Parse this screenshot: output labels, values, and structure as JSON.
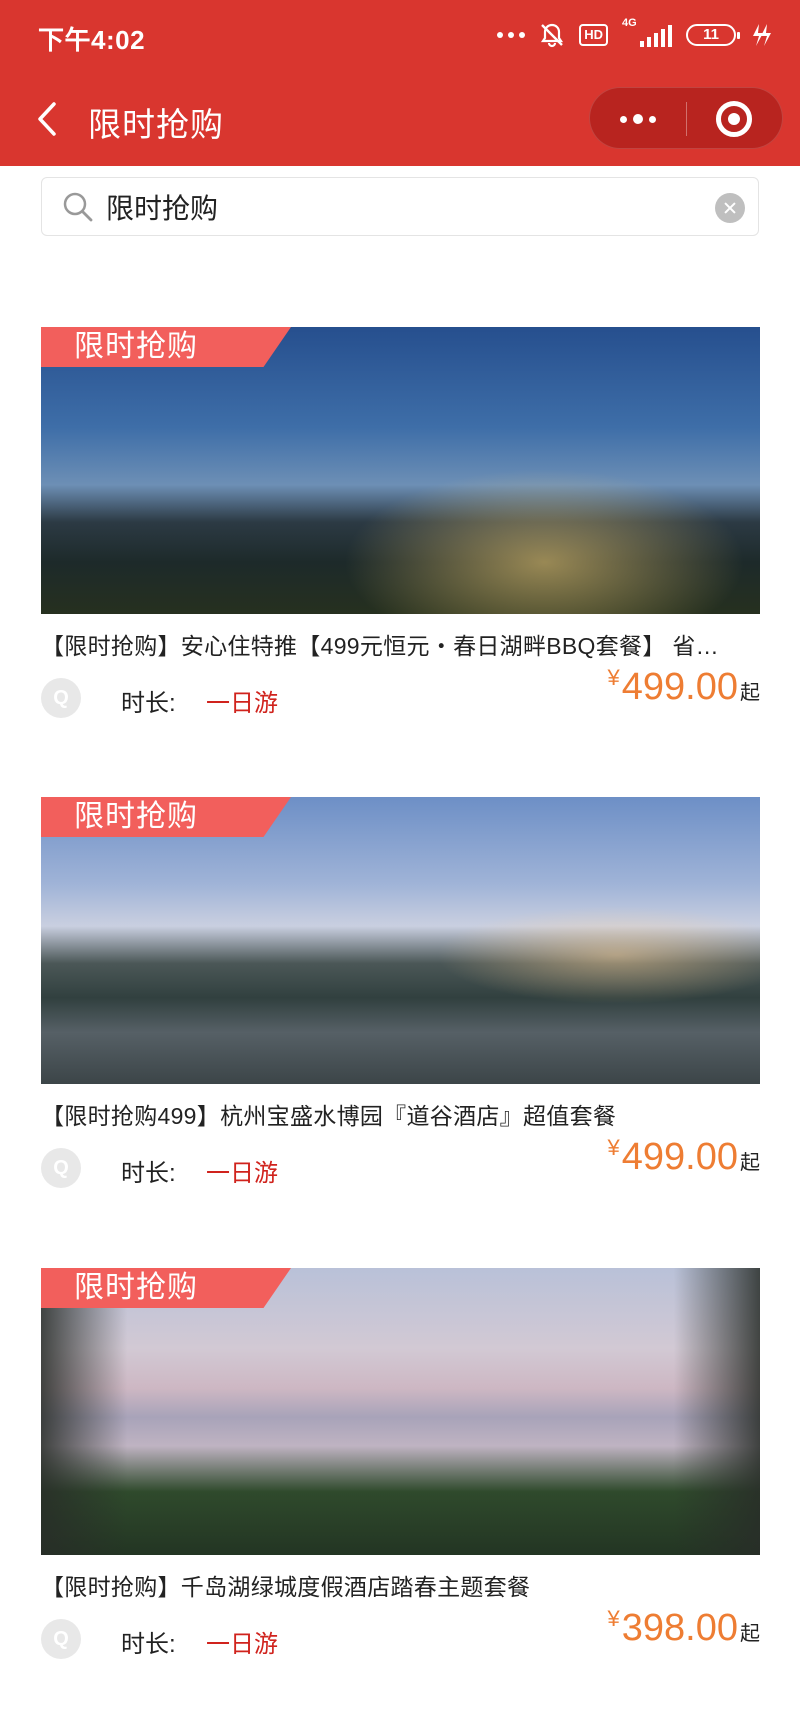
{
  "status_bar": {
    "time": "下午4:02",
    "hd_label": "HD",
    "network_label": "4G",
    "battery_level": "11"
  },
  "header": {
    "title": "限时抢购"
  },
  "search": {
    "value": "限时抢购"
  },
  "colors": {
    "brand": "#d9362f",
    "badge": "#f25f5c",
    "price": "#ee7d33",
    "duration": "#d0231d"
  },
  "items": [
    {
      "badge": "限时抢购",
      "name": "【限时抢购】安心住特推【499元恒元・春日湖畔BBQ套餐】 省…",
      "avatar": "Q",
      "duration_label": "时长:",
      "duration_value": "一日游",
      "currency": "¥",
      "price": "499.00",
      "price_suffix": "起"
    },
    {
      "badge": "限时抢购",
      "name": "【限时抢购499】杭州宝盛水博园『道谷酒店』超值套餐",
      "avatar": "Q",
      "duration_label": "时长:",
      "duration_value": "一日游",
      "currency": "¥",
      "price": "499.00",
      "price_suffix": "起"
    },
    {
      "badge": "限时抢购",
      "name": "【限时抢购】千岛湖绿城度假酒店踏春主题套餐",
      "avatar": "Q",
      "duration_label": "时长:",
      "duration_value": "一日游",
      "currency": "¥",
      "price": "398.00",
      "price_suffix": "起"
    }
  ]
}
